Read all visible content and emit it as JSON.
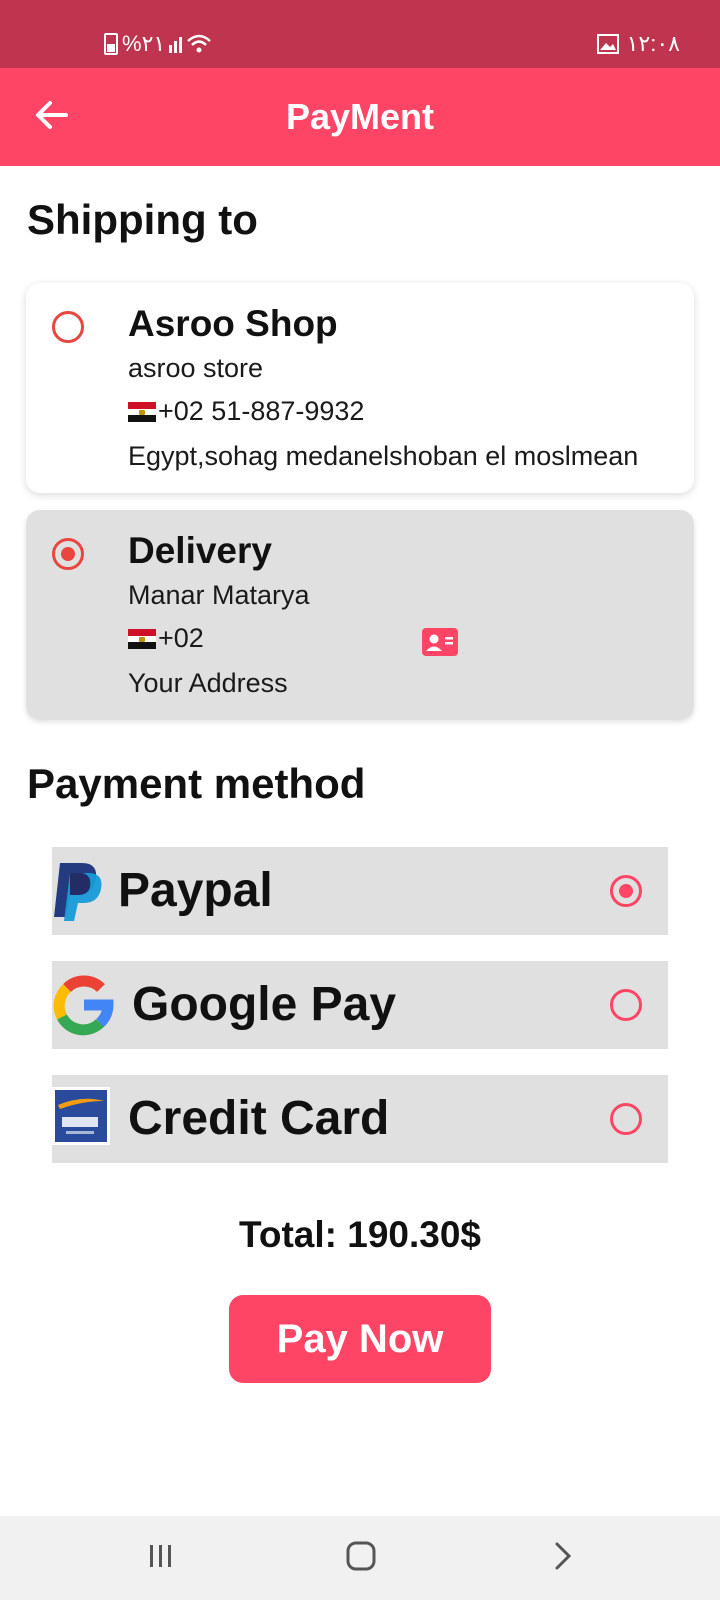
{
  "status_bar": {
    "battery_text": "%٢١",
    "time": "١٢:٠٨"
  },
  "app_bar": {
    "title": "PayMent",
    "back_icon": "arrow-left-icon"
  },
  "shipping": {
    "title": "Shipping to",
    "addresses": [
      {
        "name": "Asroo Shop",
        "subtitle": "asroo store",
        "phone": "+02 51-887-9932",
        "address": "Egypt,sohag medanelshoban el moslmean",
        "selected": false
      },
      {
        "name": "Delivery",
        "subtitle": "Manar Matarya",
        "phone": "+02",
        "address": "Your Address",
        "selected": true
      }
    ]
  },
  "payment": {
    "title": "Payment method",
    "methods": [
      {
        "label": "Paypal",
        "icon": "paypal-logo",
        "selected": true
      },
      {
        "label": "Google Pay",
        "icon": "google-logo",
        "selected": false
      },
      {
        "label": "Credit Card",
        "icon": "credit-card-logo",
        "selected": false
      }
    ]
  },
  "total": "Total: 190.30$",
  "pay_button": "Pay Now",
  "colors": {
    "status_bar": "#bf344e",
    "accent": "#ff4566",
    "radio": "#e8463f",
    "card_grey": "#e0e0e0"
  }
}
